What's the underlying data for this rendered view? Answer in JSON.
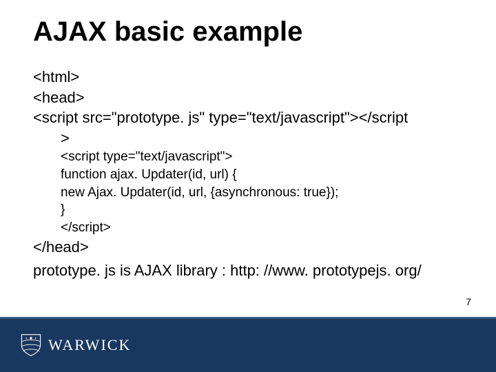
{
  "title": "AJAX basic example",
  "code": {
    "l1": "<html>",
    "l2": "<head>",
    "l3": "<script src=\"prototype. js\" type=\"text/javascript\"></script",
    "l4": ">",
    "l5": "<script type=\"text/javascript\">",
    "l6": "function ajax. Updater(id, url) {",
    "l7": " new Ajax. Updater(id, url, {asynchronous: true});",
    "l8": "}",
    "l9": "</script>",
    "l10": "</head>"
  },
  "footnote": "prototype. js is AJAX library : http: //www. prototypejs. org/",
  "page_number": "7",
  "logo_text": "WARWICK"
}
